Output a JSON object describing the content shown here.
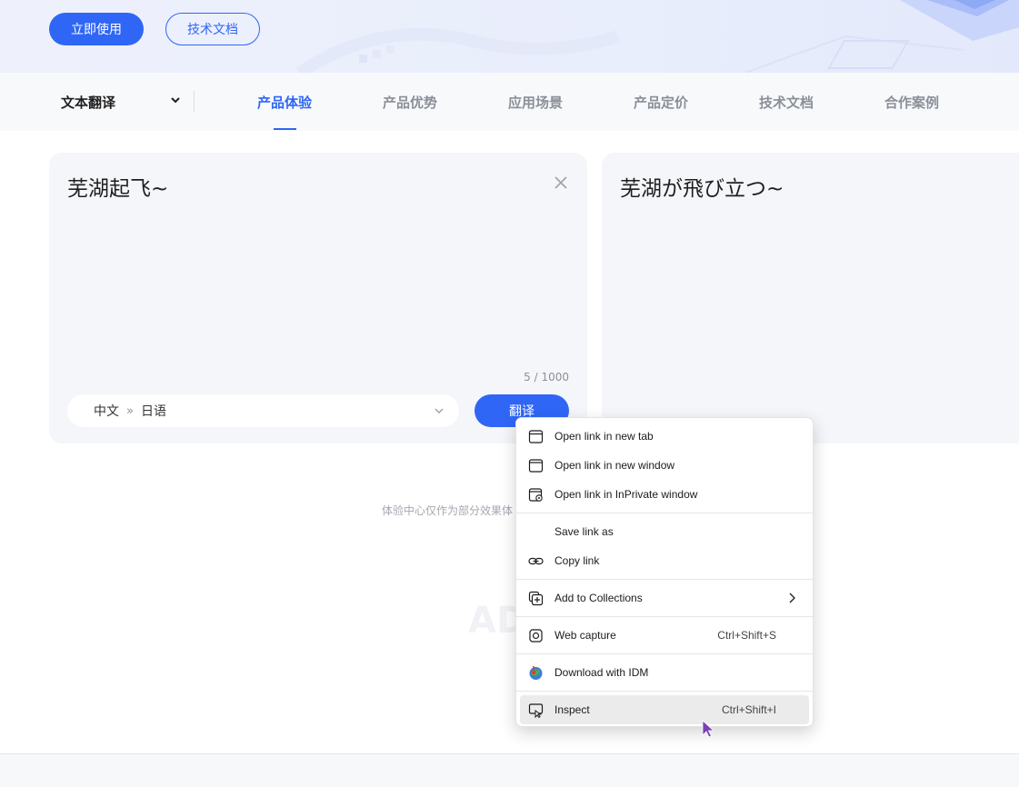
{
  "banner": {
    "start_button": "立即使用",
    "docs_button": "技术文档"
  },
  "nav": {
    "product_select": "文本翻译",
    "tabs": [
      {
        "label": "产品体验",
        "active": true
      },
      {
        "label": "产品优势",
        "active": false
      },
      {
        "label": "应用场景",
        "active": false
      },
      {
        "label": "产品定价",
        "active": false
      },
      {
        "label": "技术文档",
        "active": false
      },
      {
        "label": "合作案例",
        "active": false
      }
    ]
  },
  "translator": {
    "source_text": "芜湖起飞~",
    "char_count": "5 / 1000",
    "source_lang": "中文",
    "lang_arrow": "»",
    "target_lang": "日语",
    "translate_button": "翻译",
    "target_text": "芜湖が飛び立つ~"
  },
  "disclaimer": "体验中心仅作为部分效果体",
  "watermark": "AD",
  "context_menu": {
    "items": [
      {
        "label": "Open link in new tab",
        "icon": "new-tab-icon",
        "shortcut": ""
      },
      {
        "label": "Open link in new window",
        "icon": "new-window-icon",
        "shortcut": ""
      },
      {
        "label": "Open link in InPrivate window",
        "icon": "inprivate-icon",
        "shortcut": ""
      },
      {
        "label": "Save link as",
        "icon": "",
        "shortcut": ""
      },
      {
        "label": "Copy link",
        "icon": "link-icon",
        "shortcut": ""
      },
      {
        "label": "Add to Collections",
        "icon": "collections-icon",
        "shortcut": ""
      },
      {
        "label": "Web capture",
        "icon": "web-capture-icon",
        "shortcut": "Ctrl+Shift+S"
      },
      {
        "label": "Download with IDM",
        "icon": "idm-icon",
        "shortcut": ""
      },
      {
        "label": "Inspect",
        "icon": "inspect-icon",
        "shortcut": "Ctrl+Shift+I"
      }
    ]
  },
  "colors": {
    "accent": "#2f66f6",
    "panel_bg": "#f5f6fa",
    "nav_bg": "#f8f9fb",
    "menu_hover": "#ebebeb",
    "cursor": "#7b3fb3"
  }
}
